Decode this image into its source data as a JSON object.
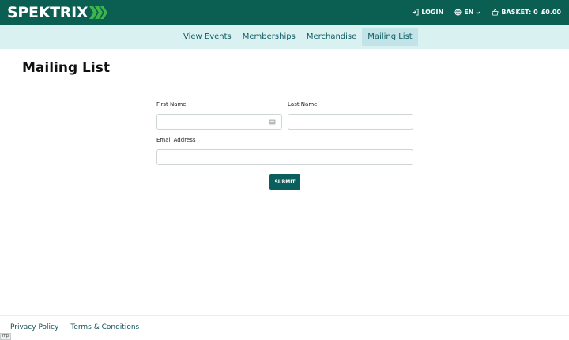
{
  "header": {
    "logo_text": "SPEKTRIX",
    "login_label": "LOGIN",
    "language_label": "EN",
    "basket_label": "BASKET: 0",
    "basket_total": "£0.00",
    "accent_color": "#3db54a",
    "background_color": "#0b5e52"
  },
  "nav": {
    "items": [
      {
        "label": "View Events"
      },
      {
        "label": "Memberships"
      },
      {
        "label": "Merchandise"
      },
      {
        "label": "Mailing List",
        "active": true
      }
    ]
  },
  "main": {
    "title": "Mailing List",
    "form": {
      "first_name_label": "First Name",
      "first_name_value": "",
      "last_name_label": "Last Name",
      "last_name_value": "",
      "email_label": "Email Address",
      "email_value": "",
      "submit_label": "SUBMIT"
    }
  },
  "footer": {
    "links": [
      {
        "label": "Privacy Policy"
      },
      {
        "label": "Terms & Conditions"
      }
    ],
    "corner_tag": "mp"
  }
}
